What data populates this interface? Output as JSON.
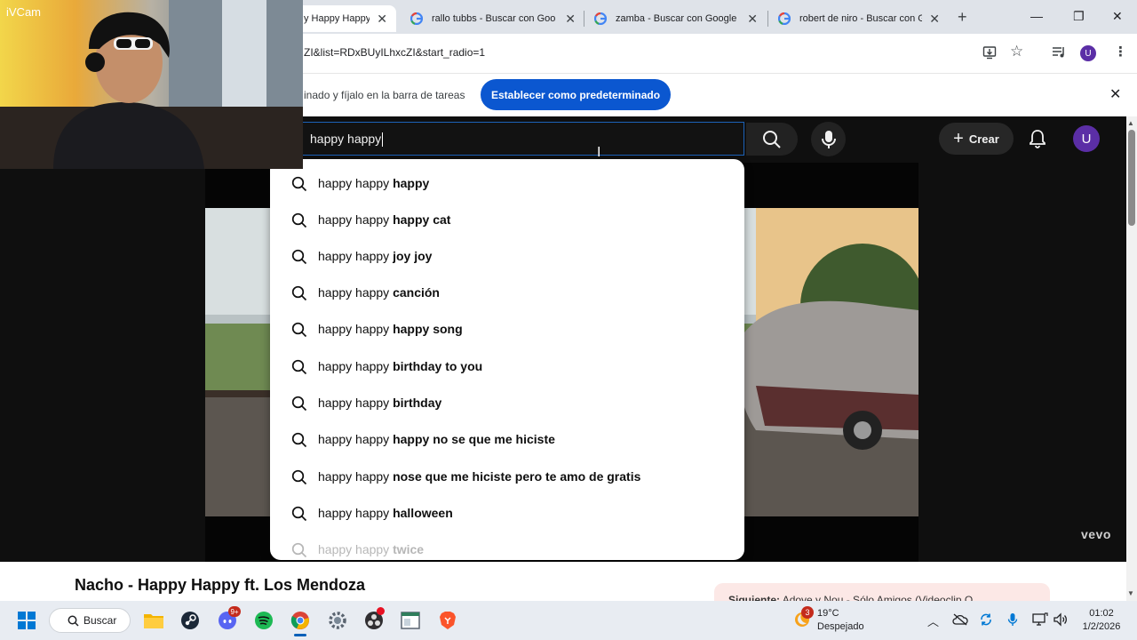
{
  "webcam": {
    "label": "iVCam"
  },
  "browser": {
    "tabs": [
      {
        "title": "y Happy Happy ft. Lo",
        "active": true
      },
      {
        "title": "rallo tubbs - Buscar con Goo",
        "active": false
      },
      {
        "title": "zamba - Buscar con Google",
        "active": false
      },
      {
        "title": "robert de niro - Buscar con G",
        "active": false
      }
    ],
    "url": "ZI&list=RDxBUyILhxcZI&start_radio=1",
    "infobar": {
      "text": "inado y fíjalo en la barra de tareas",
      "button": "Establecer como predeterminado"
    },
    "profile_initial": "U"
  },
  "youtube": {
    "search_value": "happy happy",
    "create_label": "Crear",
    "avatar_initial": "U",
    "suggestions": [
      {
        "prefix": "happy happy ",
        "bold": "happy"
      },
      {
        "prefix": "happy happy ",
        "bold": "happy cat"
      },
      {
        "prefix": "happy happy ",
        "bold": "joy joy"
      },
      {
        "prefix": "happy happy ",
        "bold": "canción"
      },
      {
        "prefix": "happy happy ",
        "bold": "happy song"
      },
      {
        "prefix": "happy happy ",
        "bold": "birthday to you"
      },
      {
        "prefix": "happy happy ",
        "bold": "birthday"
      },
      {
        "prefix": "happy happy ",
        "bold": "happy no se que me hiciste"
      },
      {
        "prefix": "happy happy ",
        "bold": "nose que me hiciste pero te amo de gratis"
      },
      {
        "prefix": "happy happy ",
        "bold": "halloween"
      },
      {
        "prefix": "happy happy ",
        "bold": "twice"
      }
    ],
    "video_title": "Nacho - Happy Happy ft. Los Mendoza",
    "watermark": "vevo",
    "next_label": "Siguiente:",
    "next_text": "Adoye y Nou - Sólo Amigos (Videoclip O..."
  },
  "taskbar": {
    "search_label": "Buscar",
    "weather_temp": "19°C",
    "weather_desc": "Despejado",
    "weather_badge": "3",
    "discord_badge": "9+",
    "time": "01:02",
    "date": "1/2/2026"
  },
  "colors": {
    "youtube_bg": "#0f0f0f",
    "accent_blue": "#0b57d0",
    "avatar_purple": "#5b2ea6",
    "taskbar_bg": "#e8ecf2"
  }
}
